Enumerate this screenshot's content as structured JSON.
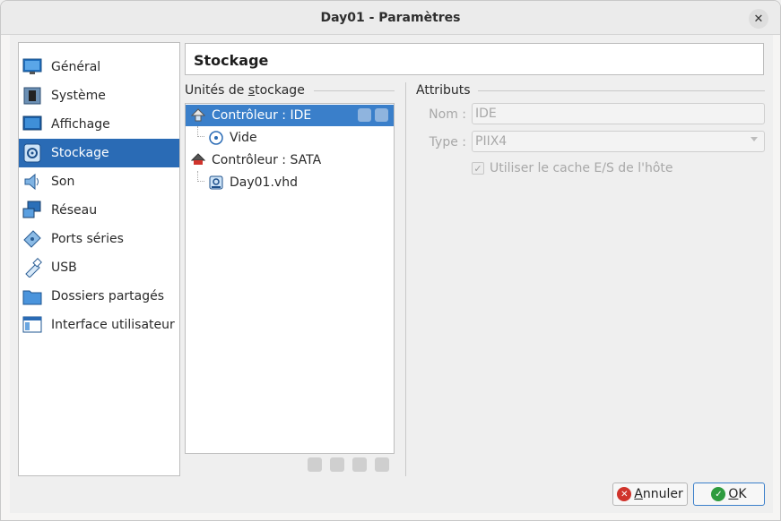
{
  "window": {
    "title": "Day01 - Paramètres",
    "close_glyph": "✕"
  },
  "sidebar": {
    "items": [
      {
        "label": "Général",
        "icon": "monitor-icon"
      },
      {
        "label": "Système",
        "icon": "chip-icon"
      },
      {
        "label": "Affichage",
        "icon": "display-icon"
      },
      {
        "label": "Stockage",
        "icon": "disk-icon",
        "selected": true
      },
      {
        "label": "Son",
        "icon": "speaker-icon"
      },
      {
        "label": "Réseau",
        "icon": "network-icon"
      },
      {
        "label": "Ports séries",
        "icon": "serial-port-icon"
      },
      {
        "label": "USB",
        "icon": "usb-icon"
      },
      {
        "label": "Dossiers partagés",
        "icon": "folder-icon"
      },
      {
        "label": "Interface utilisateur",
        "icon": "ui-window-icon"
      }
    ]
  },
  "header": {
    "title": "Stockage"
  },
  "storage": {
    "group_label_pre": "Unités de ",
    "group_label_u": "s",
    "group_label_post": "tockage",
    "tree": [
      {
        "label": "Contrôleur : IDE",
        "icon": "ide-controller-icon",
        "selected": true
      },
      {
        "label": "Vide",
        "icon": "optical-disc-icon"
      },
      {
        "label": "Contrôleur : SATA",
        "icon": "sata-controller-icon"
      },
      {
        "label": "Day01.vhd",
        "icon": "hard-disk-icon"
      }
    ]
  },
  "attributes": {
    "group_label": "Attributs",
    "name_label": "Nom :",
    "name_value": "IDE",
    "type_label": "Type :",
    "type_value": "PIIX4",
    "cache_label": "Utiliser le cache E/S de l'hôte",
    "cache_checked": true
  },
  "buttons": {
    "cancel_u": "A",
    "cancel_rest": "nnuler",
    "ok_u": "O",
    "ok_rest": "K"
  },
  "colors": {
    "selection": "#2a6bb5",
    "tree_selection": "#3a7fca",
    "cancel_icon": "#d0342c",
    "ok_icon": "#2e9b3e"
  }
}
